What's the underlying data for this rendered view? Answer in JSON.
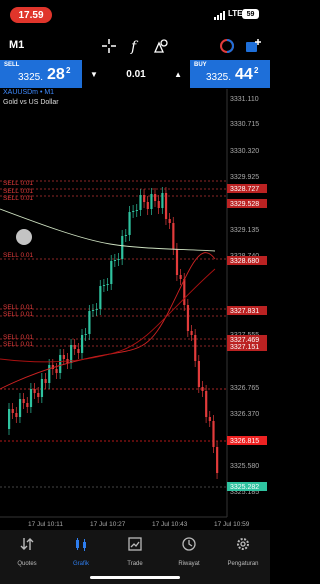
{
  "status": {
    "time": "17.59",
    "network": "LTE",
    "battery": "59"
  },
  "toolbar": {
    "timeframe": "M1"
  },
  "trade": {
    "sell_label": "SELL",
    "sell_price_main": "3325.",
    "sell_price_big": "28",
    "sell_price_sup": "2",
    "buy_label": "BUY",
    "buy_price_main": "3325.",
    "buy_price_big": "44",
    "buy_price_sup": "2",
    "lot": "0.01"
  },
  "chart": {
    "symbol": "XAUUSDm • M1",
    "description": "Gold vs US Dollar",
    "y_ticks": [
      "3331.110",
      "3330.715",
      "3330.320",
      "3329.925",
      "3329.135",
      "3328.740",
      "3327.950",
      "3327.555",
      "3326.765",
      "3326.370",
      "3325.975",
      "3325.580",
      "3325.185"
    ],
    "price_tags": [
      "3328.727",
      "3329.528",
      "3328.680",
      "3327.831",
      "3327.469",
      "3327.151",
      "3326.815",
      "3325.282"
    ],
    "sell_labels": [
      "SELL 0.01",
      "SELL 0.01",
      "SELL 0.01",
      "SELL 0.01",
      "SELL 0.01",
      "SELL 0.01",
      "SELL 0.01",
      "SELL 0.01"
    ],
    "x_ticks": [
      "17 Jul 10:11",
      "17 Jul 10:27",
      "17 Jul 10:43",
      "17 Jul 10:59"
    ]
  },
  "chart_data": {
    "type": "candlestick",
    "x": [
      "17 Jul 10:11",
      "17 Jul 10:27",
      "17 Jul 10:43",
      "17 Jul 10:59"
    ],
    "ylim": [
      3325.0,
      3331.3
    ],
    "current_price": 3325.282
  },
  "colors": {
    "up": "#2fc3a0",
    "down": "#e23b3b",
    "accent": "#1e6fd9"
  },
  "nav": {
    "items": [
      {
        "label": "Quotes",
        "icon": "quotes-icon"
      },
      {
        "label": "Grafik",
        "icon": "chart-icon"
      },
      {
        "label": "Trade",
        "icon": "trade-icon"
      },
      {
        "label": "Riwayat",
        "icon": "history-icon"
      },
      {
        "label": "Pengaturan",
        "icon": "settings-icon"
      }
    ]
  }
}
